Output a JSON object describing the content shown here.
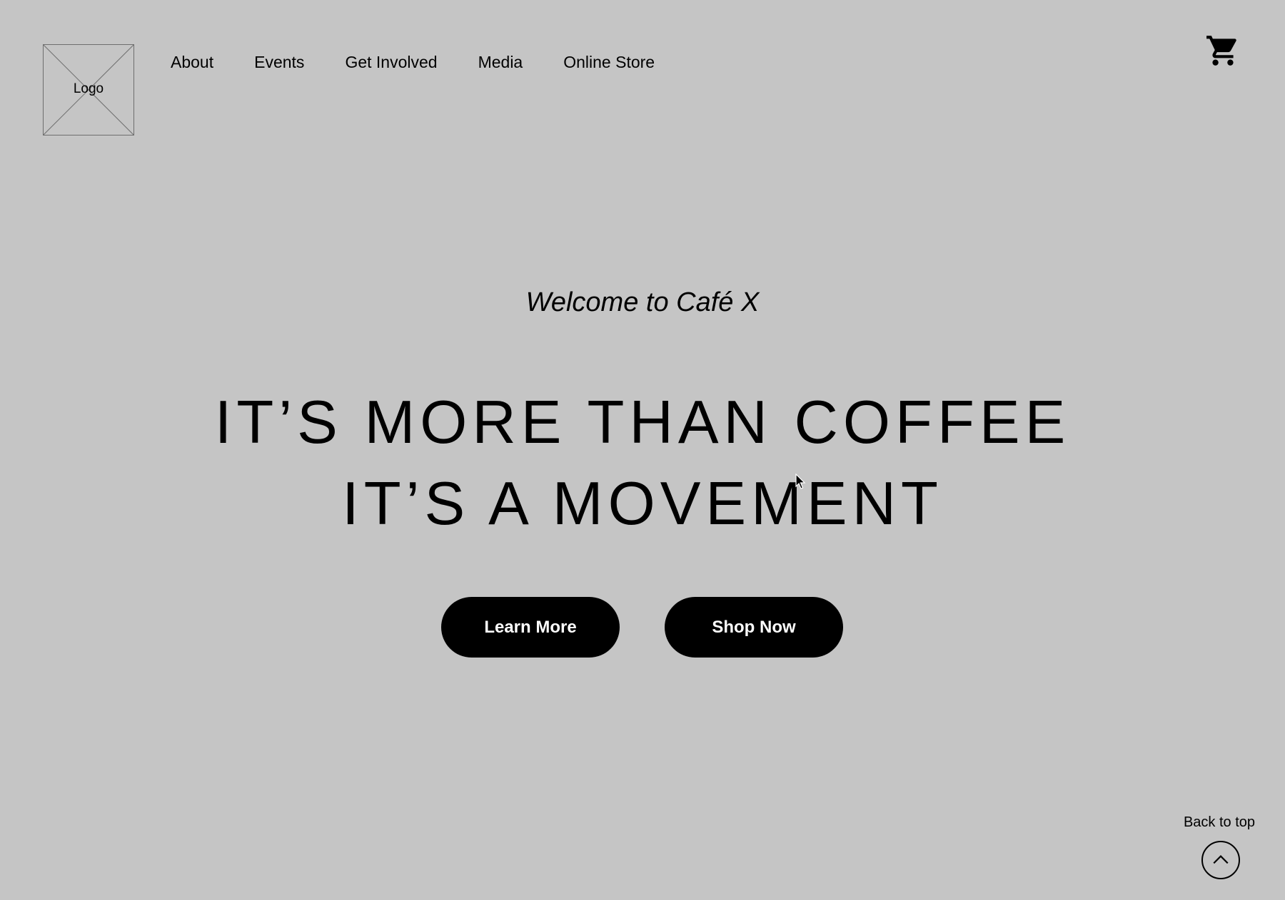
{
  "header": {
    "logo_label": "Logo",
    "nav": [
      {
        "label": "About"
      },
      {
        "label": "Events"
      },
      {
        "label": "Get Involved"
      },
      {
        "label": "Media"
      },
      {
        "label": "Online Store"
      }
    ],
    "cart_icon": "shopping-cart-icon"
  },
  "hero": {
    "welcome": "Welcome to Café X",
    "headline_line1": "IT’S MORE THAN COFFEE",
    "headline_line2": "IT’S A MOVEMENT",
    "learn_more_label": "Learn More",
    "shop_now_label": "Shop Now"
  },
  "footer": {
    "back_to_top_label": "Back to top",
    "back_to_top_icon": "chevron-up-icon"
  },
  "colors": {
    "background": "#c5c5c5",
    "button": "#000000",
    "button_text": "#ffffff"
  }
}
